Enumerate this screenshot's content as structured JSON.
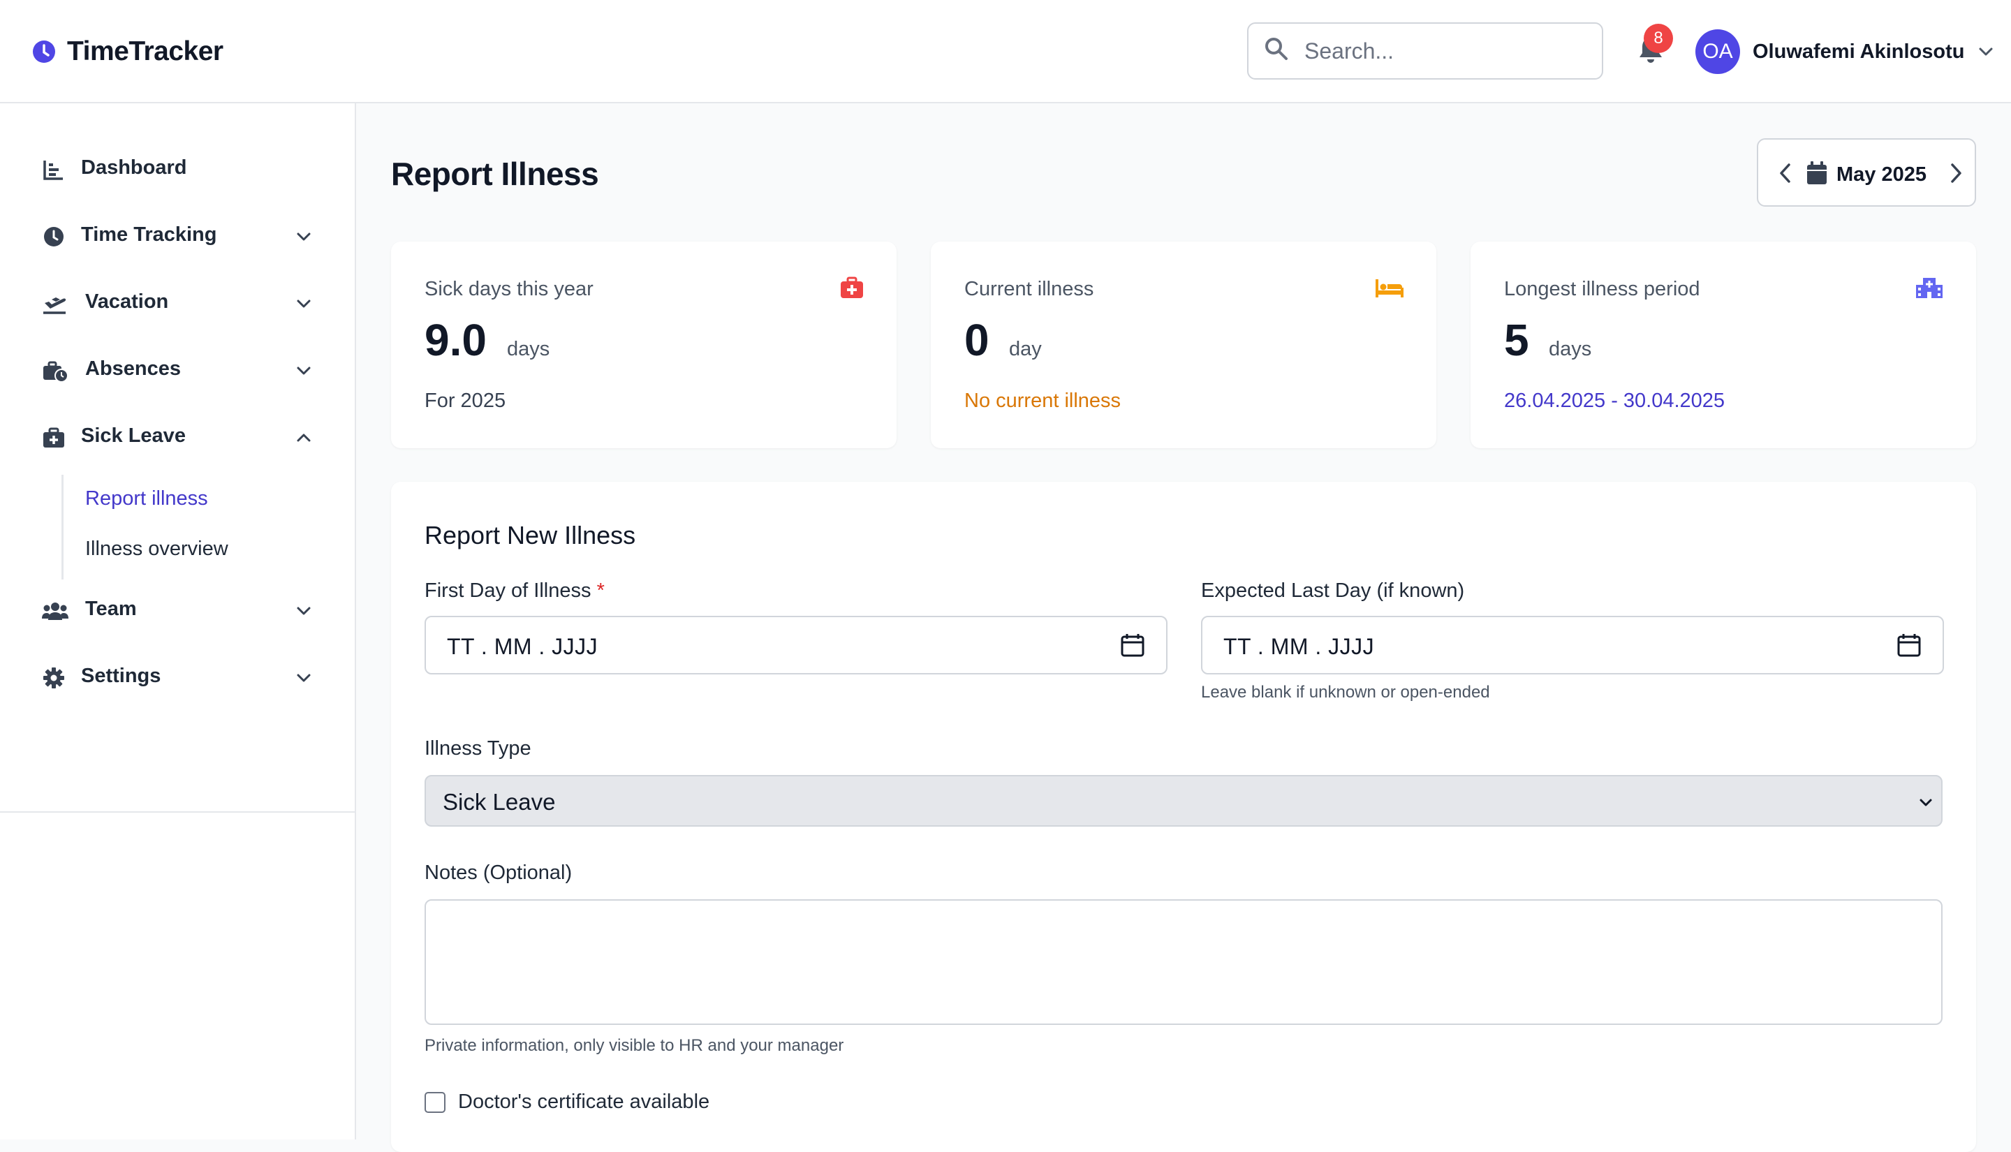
{
  "app": {
    "name": "TimeTracker",
    "brand_color": "#4f46e5"
  },
  "header": {
    "search_placeholder": "Search...",
    "notifications_count": "8",
    "user": {
      "initials": "OA",
      "name": "Oluwafemi Akinlosotu"
    }
  },
  "sidebar": {
    "items": [
      {
        "label": "Dashboard",
        "icon": "chart-bar-icon"
      },
      {
        "label": "Time Tracking",
        "icon": "clock-icon"
      },
      {
        "label": "Vacation",
        "icon": "plane-departure-icon"
      },
      {
        "label": "Absences",
        "icon": "business-time-icon"
      },
      {
        "label": "Sick Leave",
        "icon": "medkit-icon",
        "expanded": true
      },
      {
        "label": "Team",
        "icon": "users-icon"
      },
      {
        "label": "Settings",
        "icon": "gear-icon"
      }
    ],
    "sick_leave_sub": [
      {
        "label": "Report illness",
        "active": true
      },
      {
        "label": "Illness overview",
        "active": false
      }
    ]
  },
  "page": {
    "title": "Report Illness",
    "month_label": "May 2025"
  },
  "stats": [
    {
      "title": "Sick days this year",
      "value": "9.0",
      "unit": "days",
      "footer": "For 2025",
      "icon": "first-aid-kit-icon",
      "icon_color": "#ef4444",
      "footer_color": "#374151"
    },
    {
      "title": "Current illness",
      "value": "0",
      "unit": "day",
      "footer": "No current illness",
      "icon": "bed-icon",
      "icon_color": "#f59e0b",
      "footer_color": "#d97706"
    },
    {
      "title": "Longest illness period",
      "value": "5",
      "unit": "days",
      "footer": "26.04.2025 - 30.04.2025",
      "icon": "hospital-icon",
      "icon_color": "#6366f1",
      "footer_color": "#4338ca"
    }
  ],
  "form": {
    "title": "Report New Illness",
    "first_day_label": "First Day of Illness",
    "required_mark": "*",
    "first_day_placeholder": "TT . MM . JJJJ",
    "last_day_label": "Expected Last Day (if known)",
    "last_day_placeholder": "TT . MM . JJJJ",
    "last_day_hint": "Leave blank if unknown or open-ended",
    "type_label": "Illness Type",
    "type_value": "Sick Leave",
    "notes_label": "Notes (Optional)",
    "notes_value": "",
    "notes_hint": "Private information, only visible to HR and your manager",
    "certificate_label": "Doctor's certificate available",
    "certificate_checked": false
  }
}
